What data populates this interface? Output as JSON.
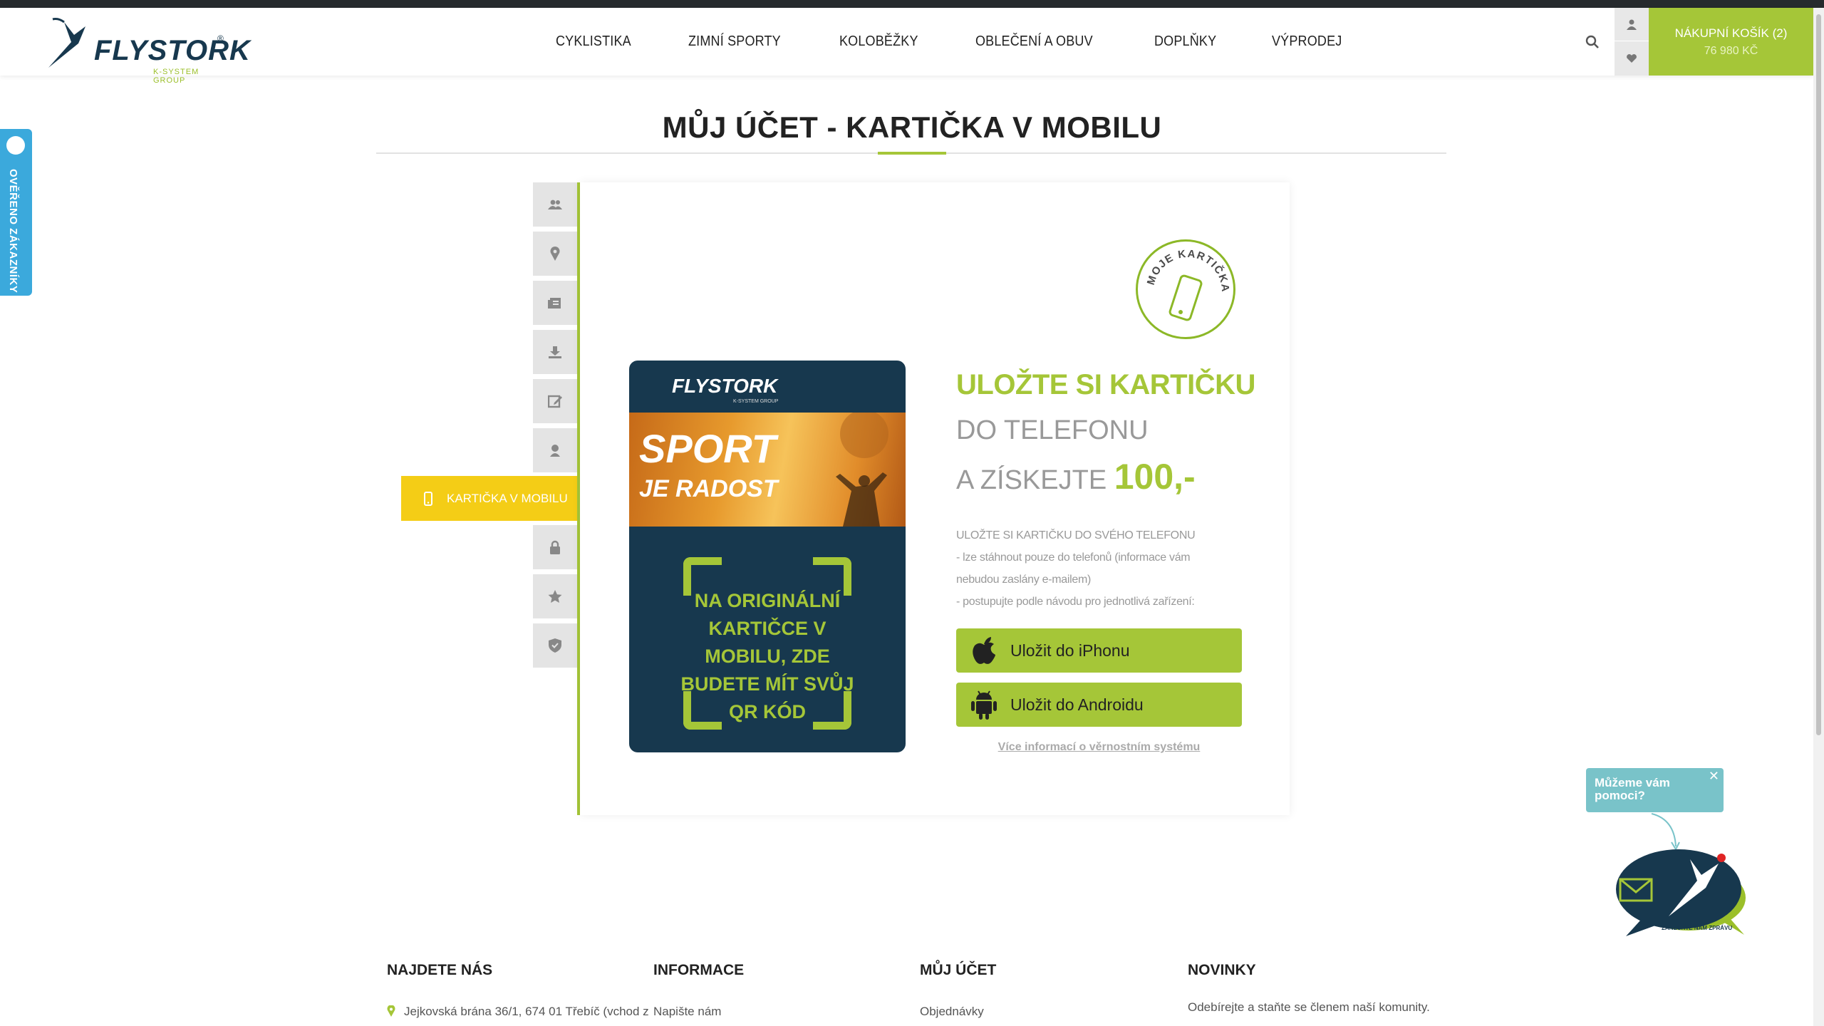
{
  "header": {
    "nav": [
      "CYKLISTIKA",
      "ZIMNÍ SPORTY",
      "KOLOBĚŽKY",
      "OBLEČENÍ A OBUV",
      "DOPLŇKY",
      "VÝPRODEJ"
    ],
    "cart_label": "NÁKUPNÍ KOŠÍK",
    "cart_count": "(2)",
    "cart_total": "76 980 KČ",
    "logo_text": "FLYSTORK",
    "logo_sub": "K-SYSTEM GROUP"
  },
  "side_tab": {
    "label": "OVĚŘENO ZÁKAZNÍKY"
  },
  "page": {
    "title": "MŮJ ÚČET - KARTIČKA V MOBILU"
  },
  "account_menu": {
    "icons": [
      "users-icon",
      "map-pin-icon",
      "orders-icon",
      "download-icon",
      "edit-icon",
      "user-badge-icon",
      "lock-icon",
      "star-icon",
      "shield-icon"
    ],
    "active_label": "KARTIČKA V MOBILU"
  },
  "stamp": {
    "text": "MOJE KARTIČKA"
  },
  "card": {
    "logo": "FLYSTORK",
    "logo_sub": "K-SYSTEM GROUP",
    "banner_line1": "SPORT",
    "banner_line2": "JE RADOST",
    "message": "NA ORIGINÁLNÍ KARTIČCE V MOBILU, ZDE BUDETE MÍT SVŮJ QR KÓD"
  },
  "promo": {
    "headline": "ULOŽTE SI KARTIČKU",
    "line2": "DO TELEFONU",
    "line3": "A ZÍSKEJTE",
    "amount": "100,-",
    "desc": [
      "ULOŽTE SI KARTIČKU DO SVÉHO TELEFONU",
      "- lze stáhnout pouze do telefonů (informace vám",
      "nebudou zaslány e-mailem)",
      "- postupujte podle návodu pro jednotlivá zařízení:"
    ],
    "btn_iphone": "Uložit do iPhonu",
    "btn_android": "Uložit do Androidu",
    "more_link": "Více informací o věrnostním systému"
  },
  "help": {
    "text": "Můžeme vám pomoci?",
    "bubble_text": "ZANECHTE NÁM ZPRÁVU"
  },
  "footer": {
    "cols": [
      {
        "title": "NAJDETE NÁS",
        "first": "Jejkovská brána 36/1, 674 01 Třebíč (vchod z"
      },
      {
        "title": "INFORMACE",
        "first": "Napište nám"
      },
      {
        "title": "MŮJ ÚČET",
        "first": "Objednávky"
      },
      {
        "title": "NOVINKY",
        "first": "Odebírejte a staňte se členem naší komunity."
      }
    ]
  },
  "colors": {
    "accent": "#a5c638",
    "active_tab": "#f4cd16",
    "brand_navy": "#17384e",
    "verified": "#3ba9dc"
  }
}
